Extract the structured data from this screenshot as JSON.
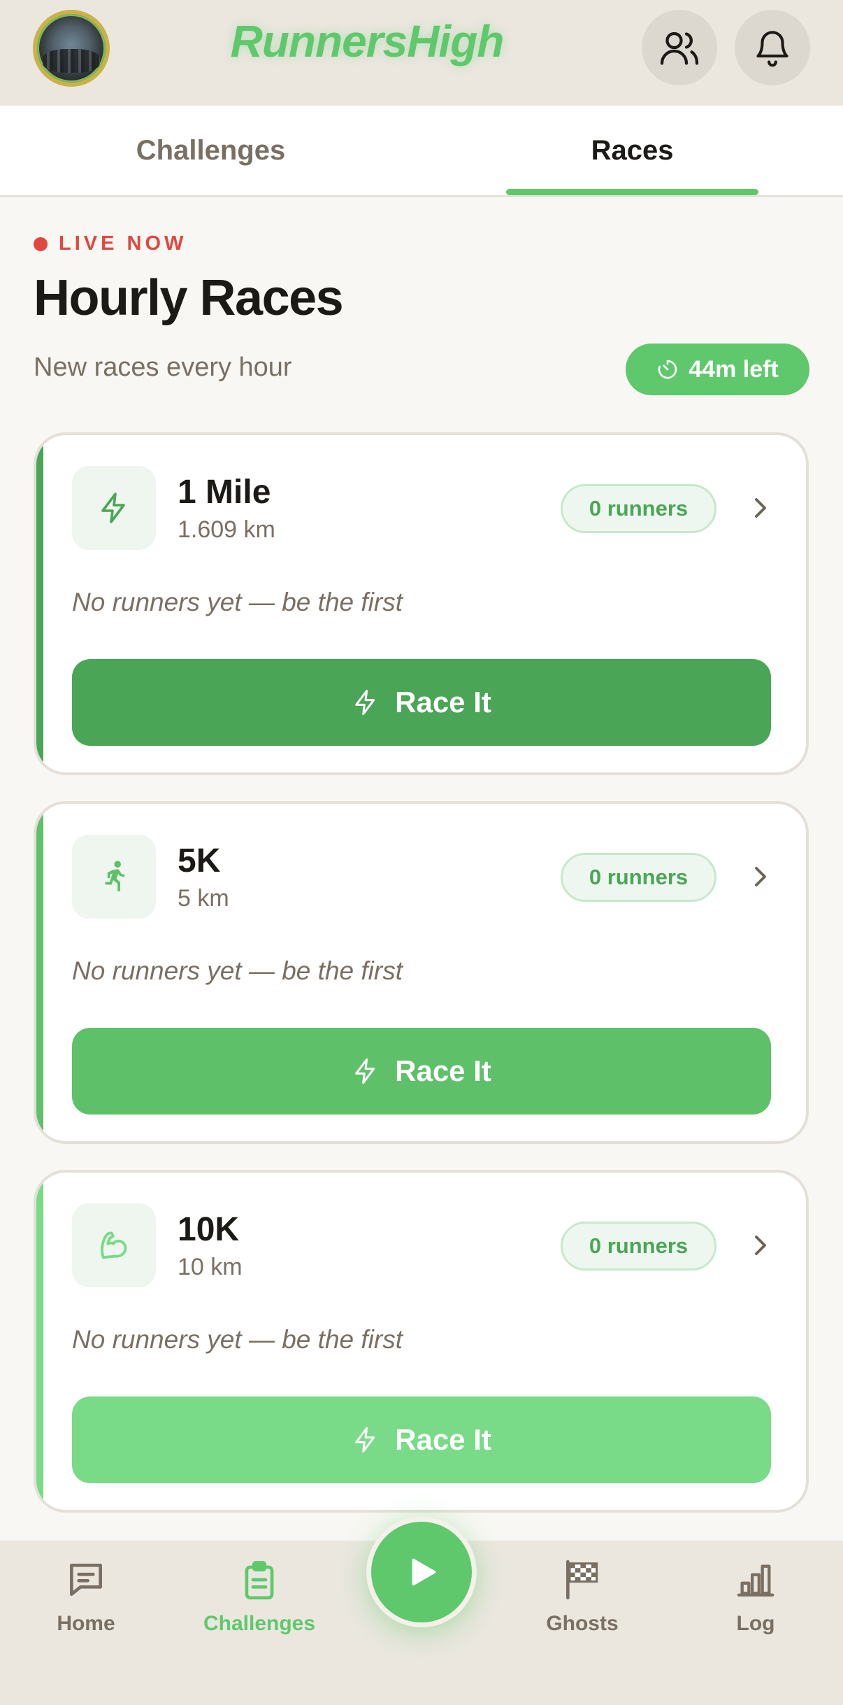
{
  "header": {
    "app_title": "RunnersHigh"
  },
  "tabs": [
    {
      "label": "Challenges",
      "active": false
    },
    {
      "label": "Races",
      "active": true
    }
  ],
  "section": {
    "live_label": "LIVE NOW",
    "title": "Hourly Races",
    "subtitle": "New races every hour",
    "timer": "44m left"
  },
  "races": [
    {
      "name": "1 Mile",
      "distance": "1.609 km",
      "runners": "0 runners",
      "empty_text": "No runners yet — be the first",
      "button_label": "Race It",
      "icon": "lightning-icon",
      "color": "#4aa557"
    },
    {
      "name": "5K",
      "distance": "5 km",
      "runners": "0 runners",
      "empty_text": "No runners yet — be the first",
      "button_label": "Race It",
      "icon": "runner-icon",
      "color": "#5fc06a"
    },
    {
      "name": "10K",
      "distance": "10 km",
      "runners": "0 runners",
      "empty_text": "No runners yet — be the first",
      "button_label": "Race It",
      "icon": "flexed-arm-icon",
      "color": "#79da88"
    }
  ],
  "bottom_nav": [
    {
      "label": "Home",
      "icon": "chat-icon",
      "active": false
    },
    {
      "label": "Challenges",
      "icon": "clipboard-icon",
      "active": true
    },
    {
      "label": "Ghosts",
      "icon": "checkered-flag-icon",
      "active": false
    },
    {
      "label": "Log",
      "icon": "bar-chart-icon",
      "active": false
    }
  ],
  "colors": {
    "brand_green": "#5fc86c",
    "live_red": "#e0473e",
    "header_bg": "#ebe7df",
    "page_bg": "#f8f7f3"
  }
}
